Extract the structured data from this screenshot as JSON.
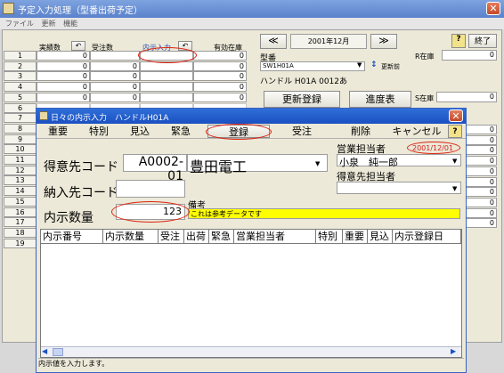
{
  "app": {
    "title": "予定入力処理（型番出荷予定）"
  },
  "menu": [
    "ファイル",
    "更新",
    "機能"
  ],
  "grid_headers": {
    "col1": "実績数",
    "col2": "受注数",
    "col3": "内示入力",
    "col4": "有効在庫"
  },
  "rows": [
    {
      "idx": "1",
      "c1": "0",
      "c2": "",
      "c4": "0"
    },
    {
      "idx": "2",
      "c1": "0",
      "c2": "0",
      "c4": "0"
    },
    {
      "idx": "3",
      "c1": "0",
      "c2": "0",
      "c4": "0"
    },
    {
      "idx": "4",
      "c1": "0",
      "c2": "0",
      "c4": "0"
    },
    {
      "idx": "5",
      "c1": "0",
      "c2": "0",
      "c4": "0"
    },
    {
      "idx": "6",
      "c1": "",
      "c2": "",
      "c4": ""
    },
    {
      "idx": "7",
      "c1": "",
      "c2": "",
      "c4": ""
    },
    {
      "idx": "8",
      "c1": "",
      "c2": "",
      "c4": ""
    },
    {
      "idx": "9",
      "c1": "",
      "c2": "",
      "c4": ""
    },
    {
      "idx": "10",
      "c1": "",
      "c2": "",
      "c4": ""
    },
    {
      "idx": "11",
      "c1": "",
      "c2": "",
      "c4": ""
    },
    {
      "idx": "12",
      "c1": "",
      "c2": "",
      "c4": ""
    },
    {
      "idx": "13",
      "c1": "",
      "c2": "",
      "c4": ""
    },
    {
      "idx": "14",
      "c1": "",
      "c2": "",
      "c4": ""
    },
    {
      "idx": "15",
      "c1": "",
      "c2": "",
      "c4": ""
    },
    {
      "idx": "16",
      "c1": "",
      "c2": "",
      "c4": ""
    },
    {
      "idx": "17",
      "c1": "",
      "c2": "",
      "c4": ""
    },
    {
      "idx": "18",
      "c1": "",
      "c2": "",
      "c4": ""
    },
    {
      "idx": "19",
      "c1": "",
      "c2": "",
      "c4": ""
    }
  ],
  "right_panel": {
    "prev": "≪",
    "month": "2001年12月",
    "next": "≫",
    "help": "?",
    "end": "終了",
    "model_label": "型番",
    "model_value": "SW1H01A",
    "sort_label": "更新前",
    "product_name": "ハンドル H01A 0012あ",
    "r_stock_label": "R在庫",
    "r_stock_value": "0",
    "s_stock_label": "S在庫",
    "s_stock_value": "0",
    "update_button": "更新登録",
    "progress_button": "進度表",
    "stock_values": [
      "0",
      "0",
      "0",
      "0",
      "0",
      "0",
      "0",
      "0",
      "0",
      "0"
    ]
  },
  "dialog": {
    "title": "日々の内示入力　ハンドルH01A",
    "toolbar": [
      "重要",
      "特別",
      "見込",
      "緊急",
      "登録",
      "受注",
      "削除",
      "キャンセル",
      "?"
    ],
    "customer_label": "得意先コード",
    "customer_code": "A0002-01",
    "customer_name": "豊田電工",
    "sales_person_label": "営業担当者",
    "sales_date": "2001/12/01",
    "sales_person_value": "小泉　純一郎",
    "client_person_label": "得意先担当者",
    "delivery_label": "納入先コード",
    "note_label": "備考",
    "note_value": "これは参考データです",
    "qty_label": "内示数量",
    "qty_value": "123",
    "grid_headers": [
      "内示番号",
      "内示数量",
      "受注",
      "出荷",
      "緊急",
      "営業担当者",
      "特別",
      "重要",
      "見込",
      "内示登録日"
    ],
    "status": "内示値を入力します。"
  },
  "colors": {
    "accent_red": "#d21f1f",
    "note_bg": "#ffff00",
    "title_blue": "#1b50c2"
  }
}
